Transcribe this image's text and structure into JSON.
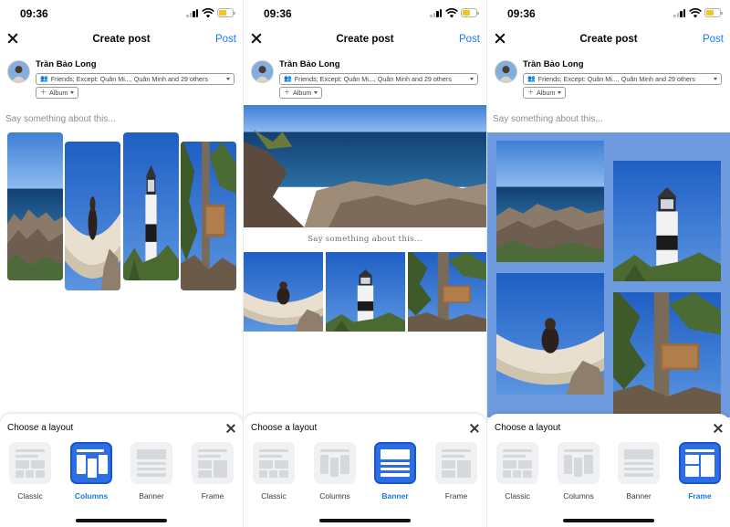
{
  "status": {
    "time": "09:36"
  },
  "nav": {
    "title": "Create post",
    "post_label": "Post"
  },
  "author": {
    "name": "Trần Bảo Long",
    "audience": "Friends; Except: Quân Mi..., Quân Minh and 29 others",
    "album_label": "Album"
  },
  "composer": {
    "placeholder": "Say something about this...",
    "banner_caption": "Say something about this..."
  },
  "layout_sheet": {
    "title": "Choose a layout",
    "options": [
      "Classic",
      "Columns",
      "Banner",
      "Frame"
    ]
  },
  "screens": [
    {
      "selected_layout": "Columns"
    },
    {
      "selected_layout": "Banner"
    },
    {
      "selected_layout": "Frame"
    }
  ],
  "colors": {
    "accent": "#1877f2",
    "selected_tile": "#2d6ee6",
    "frame_background": "#6e9ae0"
  },
  "icons": [
    "close-icon",
    "signal-icon",
    "wifi-icon",
    "battery-icon",
    "people-icon",
    "plus-icon",
    "chevron-down-icon"
  ]
}
